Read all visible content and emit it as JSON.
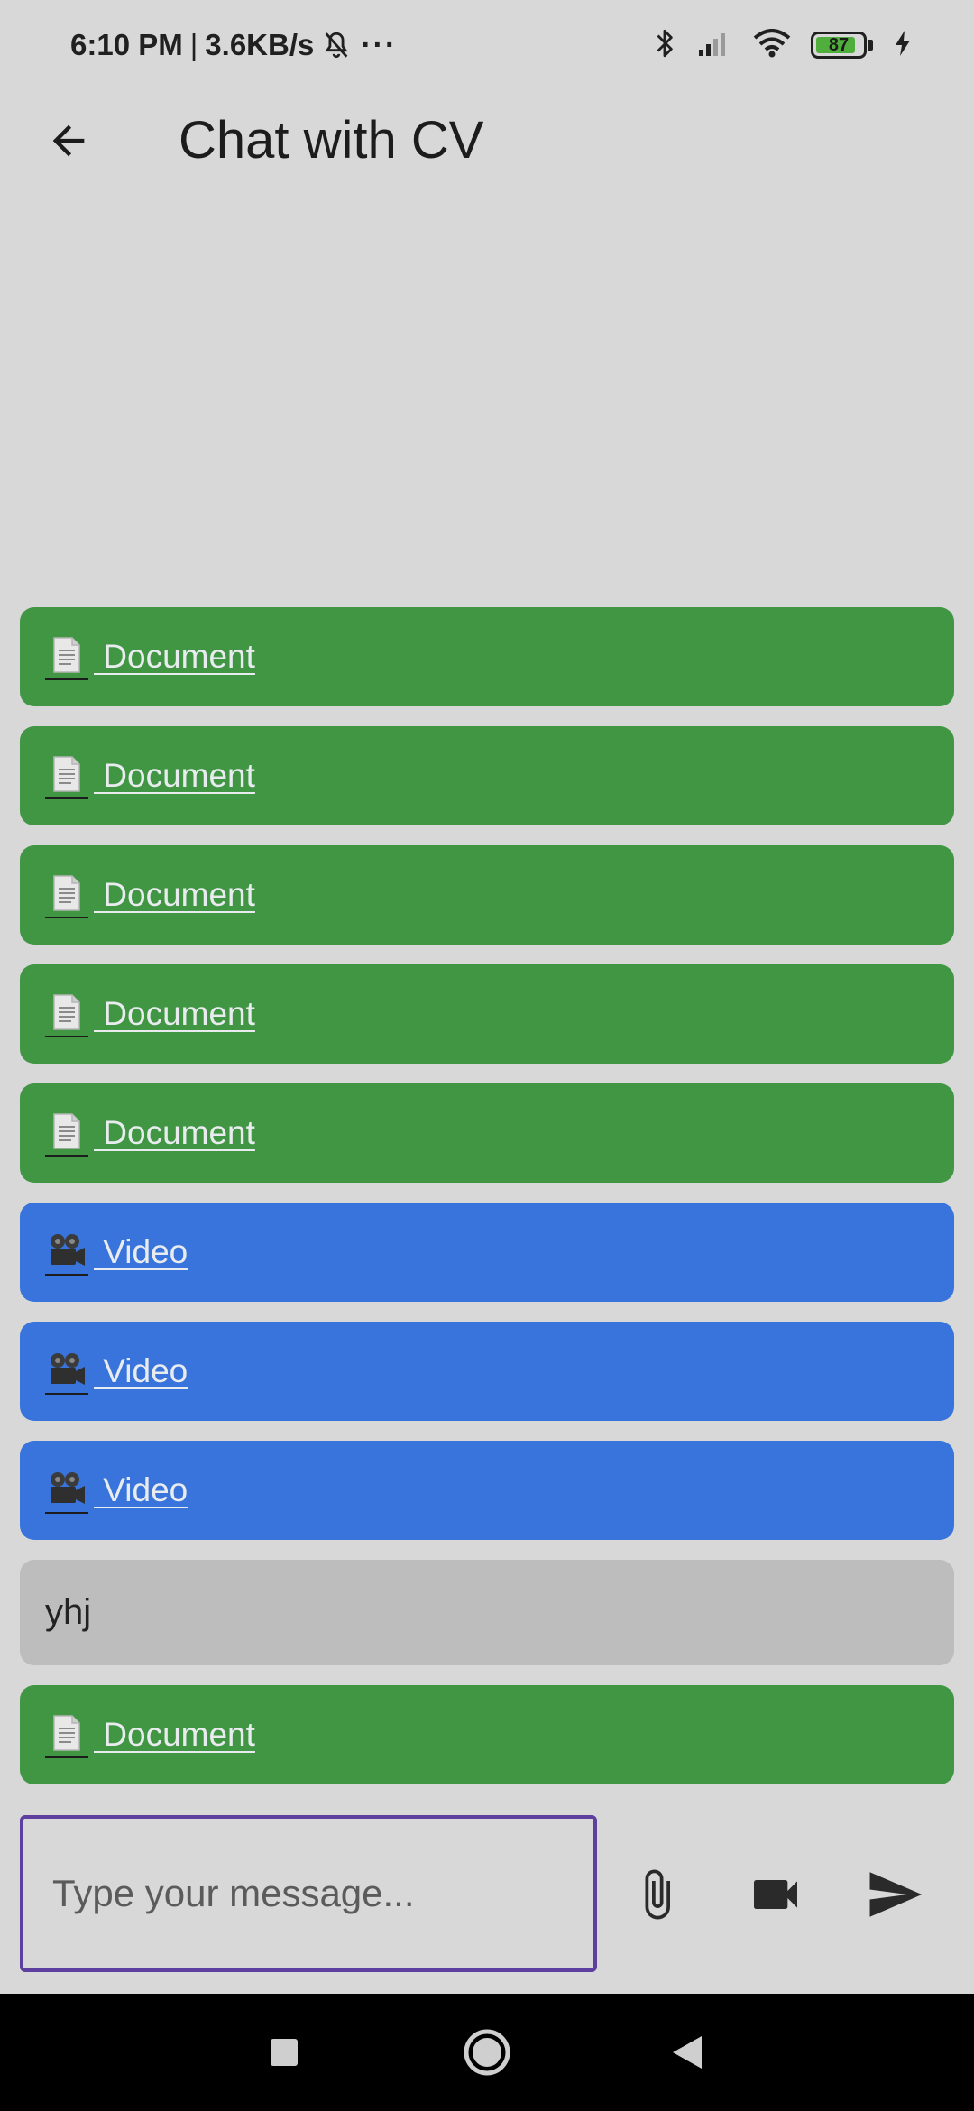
{
  "status_bar": {
    "time": "6:10 PM",
    "separator": "|",
    "network_speed": "3.6KB/s",
    "more": "···",
    "battery_level": "87",
    "battery_fraction": 0.87
  },
  "app_bar": {
    "title": "Chat with CV",
    "back_icon": "arrow-back-icon"
  },
  "messages": [
    {
      "type": "document",
      "label": " Document",
      "icon": "document-icon"
    },
    {
      "type": "document",
      "label": " Document",
      "icon": "document-icon"
    },
    {
      "type": "document",
      "label": " Document",
      "icon": "document-icon"
    },
    {
      "type": "document",
      "label": " Document",
      "icon": "document-icon"
    },
    {
      "type": "document",
      "label": " Document",
      "icon": "document-icon"
    },
    {
      "type": "video",
      "label": " Video",
      "icon": "video-camera-icon"
    },
    {
      "type": "video",
      "label": " Video",
      "icon": "video-camera-icon"
    },
    {
      "type": "video",
      "label": " Video",
      "icon": "video-camera-icon"
    },
    {
      "type": "text",
      "label": "yhj"
    },
    {
      "type": "document",
      "label": " Document",
      "icon": "document-icon"
    }
  ],
  "composer": {
    "placeholder": "Type your message...",
    "value": "",
    "attach_icon": "paperclip-icon",
    "video_icon": "videocam-icon",
    "send_icon": "send-icon"
  },
  "colors": {
    "document_bubble": "#419644",
    "video_bubble": "#3874db",
    "text_bubble": "#bdbdbd",
    "input_border": "#5c3f9e",
    "background": "#d9d8d9"
  }
}
